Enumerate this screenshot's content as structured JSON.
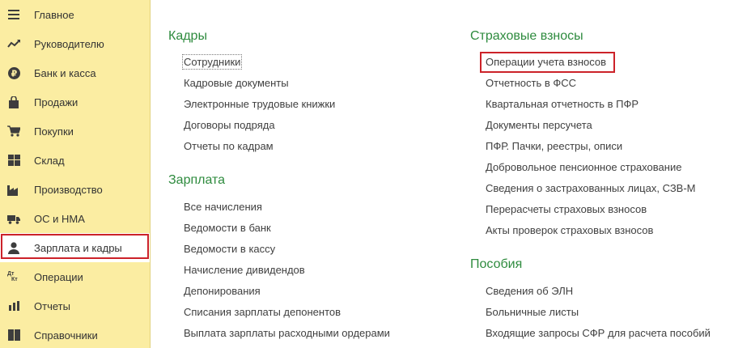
{
  "sidebar": {
    "items": [
      {
        "label": "Главное",
        "icon": "menu-lines-icon"
      },
      {
        "label": "Руководителю",
        "icon": "trend-chart-icon"
      },
      {
        "label": "Банк и касса",
        "icon": "ruble-coin-icon"
      },
      {
        "label": "Продажи",
        "icon": "shopping-bag-icon"
      },
      {
        "label": "Покупки",
        "icon": "cart-icon"
      },
      {
        "label": "Склад",
        "icon": "warehouse-grid-icon"
      },
      {
        "label": "Производство",
        "icon": "factory-icon"
      },
      {
        "label": "ОС и НМА",
        "icon": "truck-icon"
      },
      {
        "label": "Зарплата и кадры",
        "icon": "person-icon"
      },
      {
        "label": "Операции",
        "icon": "debit-credit-icon",
        "icon_text_top": "Дт",
        "icon_text_bottom": "Кт"
      },
      {
        "label": "Отчеты",
        "icon": "bar-chart-icon"
      },
      {
        "label": "Справочники",
        "icon": "book-icon"
      }
    ],
    "active_index": 8,
    "highlight_color": "#cc2229",
    "background": "#fbeda2"
  },
  "sections": {
    "kadry": {
      "title": "Кадры",
      "links": [
        "Сотрудники",
        "Кадровые документы",
        "Электронные трудовые книжки",
        "Договоры подряда",
        "Отчеты по кадрам"
      ]
    },
    "zarplata": {
      "title": "Зарплата",
      "links": [
        "Все начисления",
        "Ведомости в банк",
        "Ведомости в кассу",
        "Начисление дивидендов",
        "Депонирования",
        "Списания зарплаты депонентов",
        "Выплата зарплаты расходными ордерами"
      ]
    },
    "strakh": {
      "title": "Страховые взносы",
      "links": [
        "Операции учета взносов",
        "Отчетность в ФСС",
        "Квартальная отчетность в ПФР",
        "Документы персучета",
        "ПФР. Пачки, реестры, описи",
        "Добровольное пенсионное страхование",
        "Сведения о застрахованных лицах, СЗВ-М",
        "Перерасчеты страховых взносов",
        "Акты проверок страховых взносов"
      ]
    },
    "posobiya": {
      "title": "Пособия",
      "links": [
        "Сведения об ЭЛН",
        "Больничные листы",
        "Входящие запросы СФР для расчета пособий"
      ]
    }
  },
  "colors": {
    "section_title": "#2e8b3e",
    "link_text": "#404040",
    "highlight": "#cc2229"
  }
}
